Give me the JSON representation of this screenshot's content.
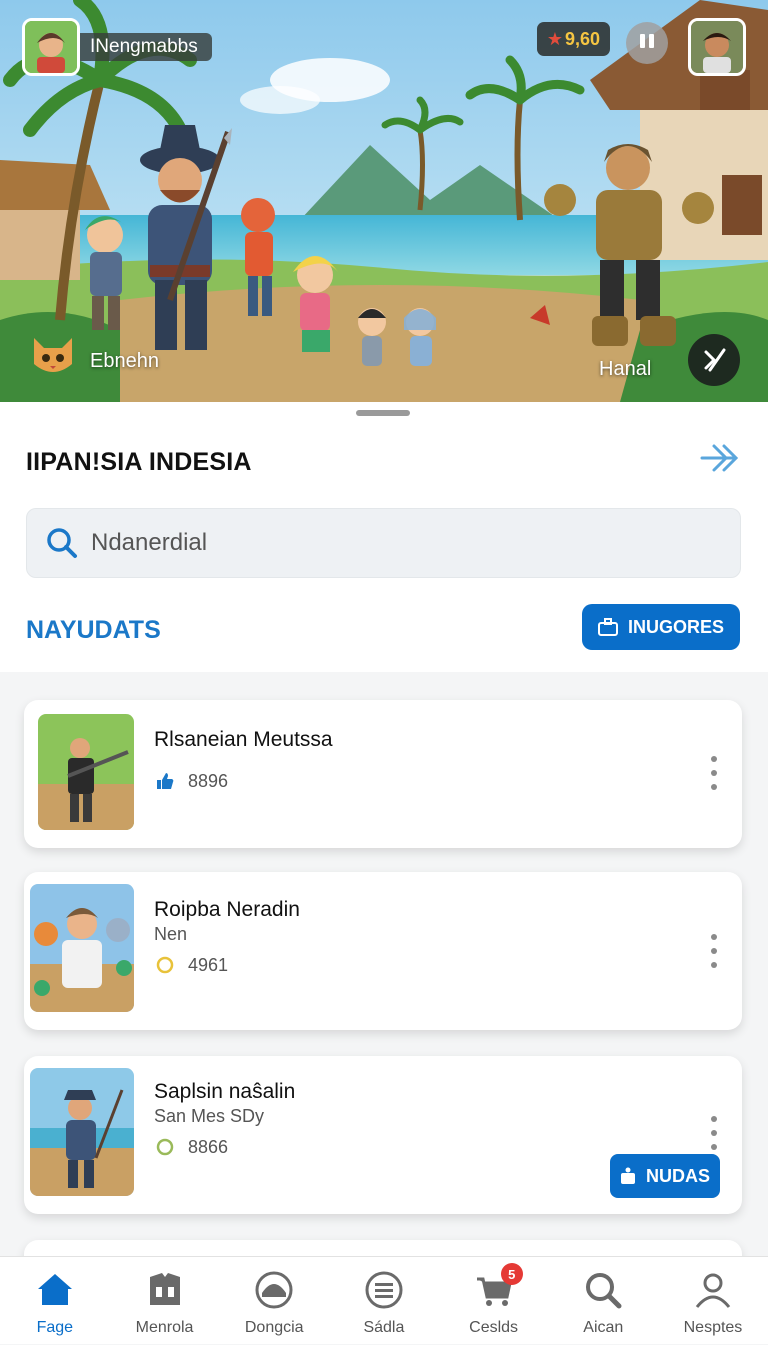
{
  "hero": {
    "player_name": "INengmabbs",
    "coins": "9,60",
    "left_character_label": "Ebnehn",
    "right_character_label": "Hanal"
  },
  "header": {
    "title": "IIPAN!SIA INDESIA"
  },
  "search": {
    "placeholder": "Ndanerdial"
  },
  "section": {
    "title": "NAYUDATS",
    "action_label": "INUGORES"
  },
  "games": [
    {
      "name": "Rlsaneian Meutssa",
      "subtitle": "",
      "stat": "8896",
      "stat_icon": "thumbs-up-icon"
    },
    {
      "name": "Roipba Neradin",
      "subtitle": "Nen",
      "stat": "4961",
      "stat_icon": "ring-icon"
    },
    {
      "name": "Saplsin naŝalin",
      "subtitle": "San Mes SDy",
      "stat": "8866",
      "stat_icon": "ring-icon",
      "button_label": "NUDAS"
    }
  ],
  "tabs": [
    {
      "label": "Fage",
      "icon": "home-icon",
      "active": true
    },
    {
      "label": "Menrola",
      "icon": "store-icon",
      "active": false
    },
    {
      "label": "Dongcia",
      "icon": "dish-icon",
      "active": false
    },
    {
      "label": "Sádla",
      "icon": "list-icon",
      "active": false
    },
    {
      "label": "Ceslds",
      "icon": "cart-icon",
      "active": false,
      "badge": "5"
    },
    {
      "label": "Aican",
      "icon": "search-icon",
      "active": false
    },
    {
      "label": "Nesptes",
      "icon": "profile-icon",
      "active": false
    }
  ],
  "colors": {
    "accent": "#0a6ec9",
    "section_title": "#1b78c8",
    "badge": "#e53935",
    "coin": "#f5c542"
  }
}
